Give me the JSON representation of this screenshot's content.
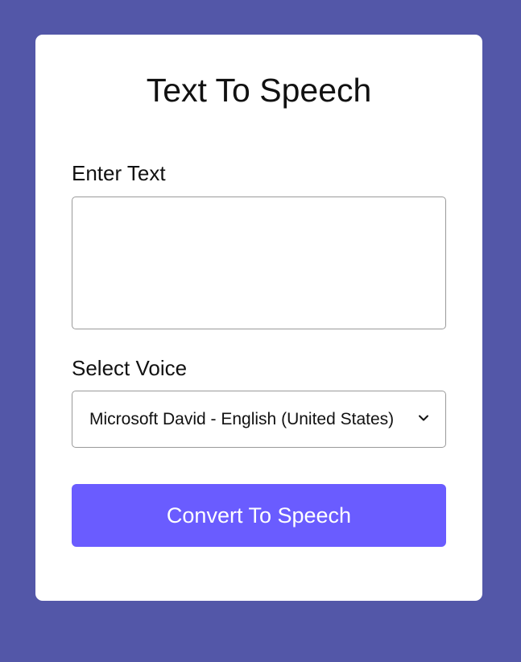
{
  "app": {
    "title": "Text To Speech"
  },
  "form": {
    "text_label": "Enter Text",
    "text_value": "",
    "voice_label": "Select Voice",
    "voice_selected": "Microsoft David - English (United States)",
    "submit_label": "Convert To Speech"
  },
  "colors": {
    "background": "#5357a8",
    "card": "#ffffff",
    "accent": "#6a5cff"
  },
  "icons": {
    "select_arrow": "chevron-down-icon"
  }
}
